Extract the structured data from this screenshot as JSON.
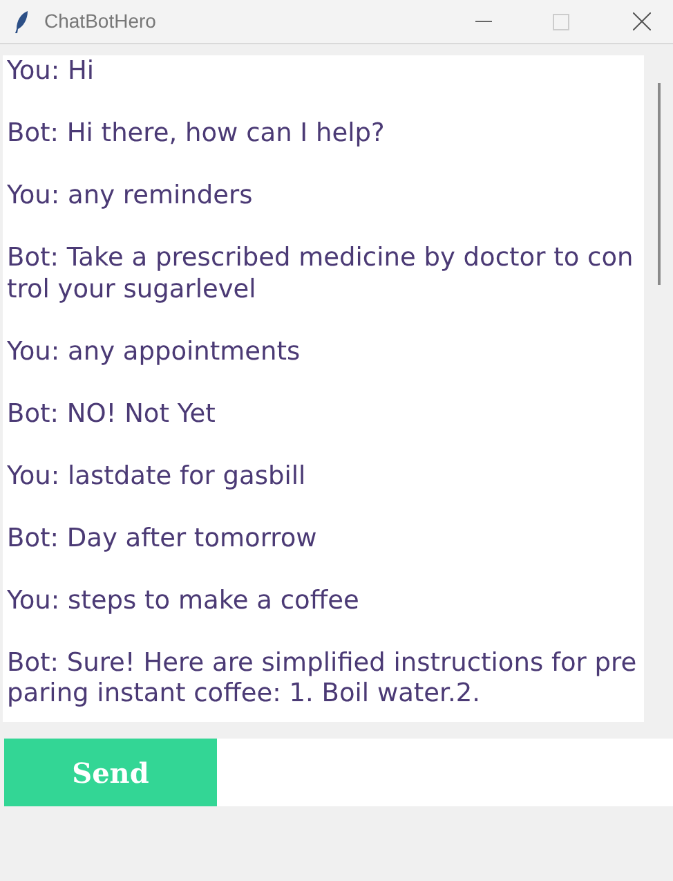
{
  "window": {
    "title": "ChatBotHero"
  },
  "messages": [
    "You: Hi",
    "Bot: Hi there, how can I help?",
    "You: any reminders",
    "Bot: Take a prescribed medicine by doctor to control your sugarlevel",
    "You: any appointments",
    "Bot: NO! Not Yet",
    "You: lastdate for gasbill",
    "Bot: Day after tomorrow",
    "You: steps to make a coffee",
    "Bot: Sure! Here are simplified instructions for preparing instant coffee: 1. Boil water.2."
  ],
  "send_button": "Send"
}
